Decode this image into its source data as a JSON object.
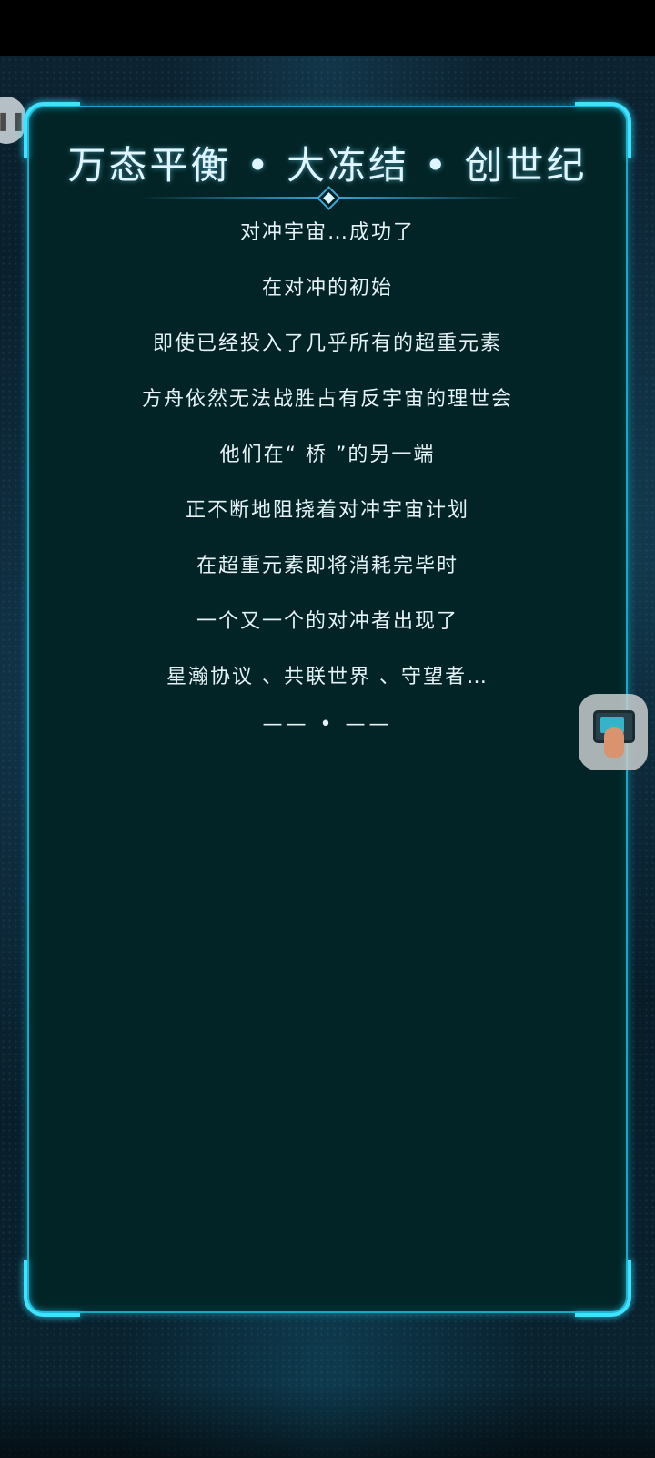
{
  "story": {
    "title": "万态平衡 • 大冻结 • 创世纪",
    "lines": [
      "对冲宇宙…成功了",
      "在对冲的初始",
      "即使已经投入了几乎所有的超重元素",
      "方舟依然无法战胜占有反宇宙的理世会",
      "他们在“ 桥 ”的另一端",
      "正不断地阻挠着对冲宇宙计划",
      "在超重元素即将消耗完毕时",
      "一个又一个的对冲者出现了",
      "星瀚协议 、共联世界 、守望者…"
    ],
    "end_mark": "—— • ——"
  },
  "overlay": {
    "left_handle_glyph": "❚❚",
    "floating_button_icon": "touch-screen-icon"
  },
  "colors": {
    "panel_bg": "#022426",
    "frame": "#14a9c4",
    "frame_glow": "#3fe3ff",
    "text": "#e6f3f6"
  }
}
